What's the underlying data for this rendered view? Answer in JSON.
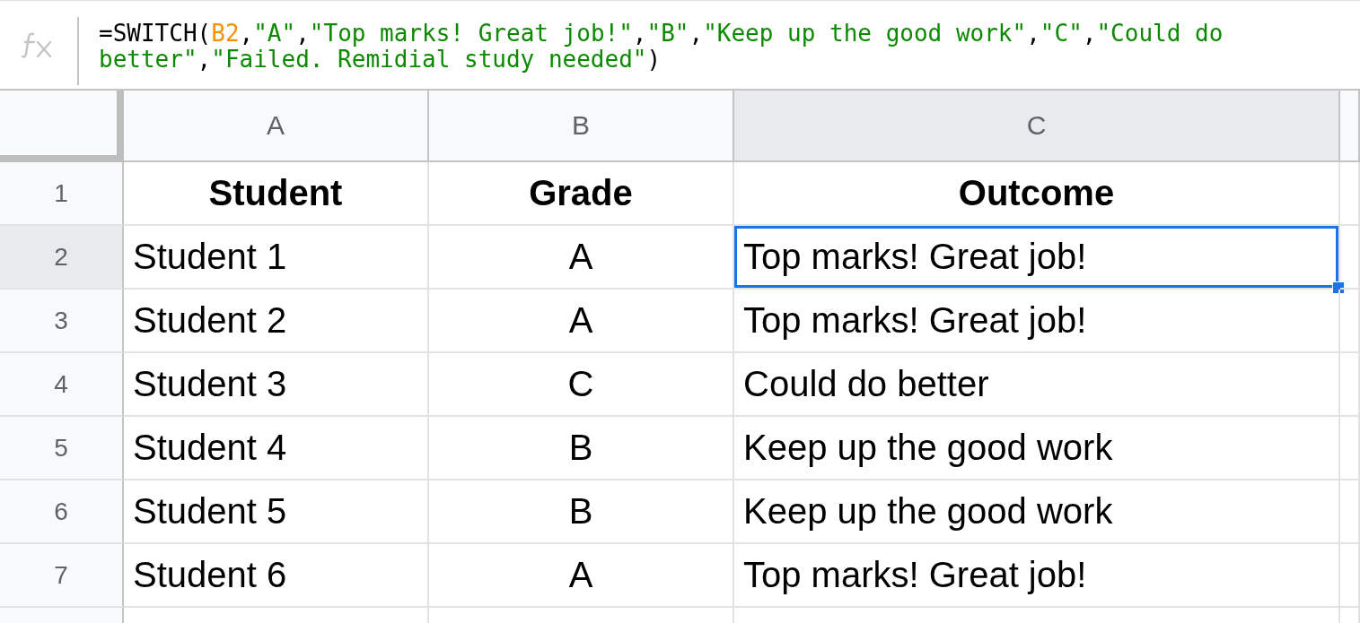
{
  "formula_bar": {
    "tokens": [
      {
        "kind": "plain",
        "text": "=SWITCH("
      },
      {
        "kind": "ref",
        "text": "B2"
      },
      {
        "kind": "plain",
        "text": ","
      },
      {
        "kind": "string",
        "text": "\"A\""
      },
      {
        "kind": "plain",
        "text": ","
      },
      {
        "kind": "string",
        "text": "\"Top marks! Great job!\""
      },
      {
        "kind": "plain",
        "text": ","
      },
      {
        "kind": "string",
        "text": "\"B\""
      },
      {
        "kind": "plain",
        "text": ","
      },
      {
        "kind": "string",
        "text": "\"Keep up the good work\""
      },
      {
        "kind": "plain",
        "text": ","
      },
      {
        "kind": "string",
        "text": "\"C\""
      },
      {
        "kind": "plain",
        "text": ","
      },
      {
        "kind": "string",
        "text": "\"Could do better\""
      },
      {
        "kind": "plain",
        "text": ","
      },
      {
        "kind": "string",
        "text": "\"Failed. Remidial study needed\""
      },
      {
        "kind": "plain",
        "text": ")"
      }
    ]
  },
  "columns": [
    {
      "label": "A",
      "selected": false
    },
    {
      "label": "B",
      "selected": false
    },
    {
      "label": "C",
      "selected": true
    }
  ],
  "rows": [
    {
      "number": "1",
      "selected": false,
      "kind": "header",
      "cells": [
        {
          "text": "Student",
          "selected": false
        },
        {
          "text": "Grade",
          "selected": false
        },
        {
          "text": "Outcome",
          "selected": false
        }
      ]
    },
    {
      "number": "2",
      "selected": true,
      "kind": "data",
      "cells": [
        {
          "text": "Student 1",
          "selected": false
        },
        {
          "text": "A",
          "selected": false
        },
        {
          "text": "Top marks! Great job!",
          "selected": true
        }
      ]
    },
    {
      "number": "3",
      "selected": false,
      "kind": "data",
      "cells": [
        {
          "text": "Student 2",
          "selected": false
        },
        {
          "text": "A",
          "selected": false
        },
        {
          "text": "Top marks! Great job!",
          "selected": false
        }
      ]
    },
    {
      "number": "4",
      "selected": false,
      "kind": "data",
      "cells": [
        {
          "text": "Student 3",
          "selected": false
        },
        {
          "text": "C",
          "selected": false
        },
        {
          "text": "Could do better",
          "selected": false
        }
      ]
    },
    {
      "number": "5",
      "selected": false,
      "kind": "data",
      "cells": [
        {
          "text": "Student 4",
          "selected": false
        },
        {
          "text": "B",
          "selected": false
        },
        {
          "text": "Keep up the good work",
          "selected": false
        }
      ]
    },
    {
      "number": "6",
      "selected": false,
      "kind": "data",
      "cells": [
        {
          "text": "Student 5",
          "selected": false
        },
        {
          "text": "B",
          "selected": false
        },
        {
          "text": "Keep up the good work",
          "selected": false
        }
      ]
    },
    {
      "number": "7",
      "selected": false,
      "kind": "data",
      "cells": [
        {
          "text": "Student 6",
          "selected": false
        },
        {
          "text": "A",
          "selected": false
        },
        {
          "text": "Top marks! Great job!",
          "selected": false
        }
      ]
    }
  ]
}
